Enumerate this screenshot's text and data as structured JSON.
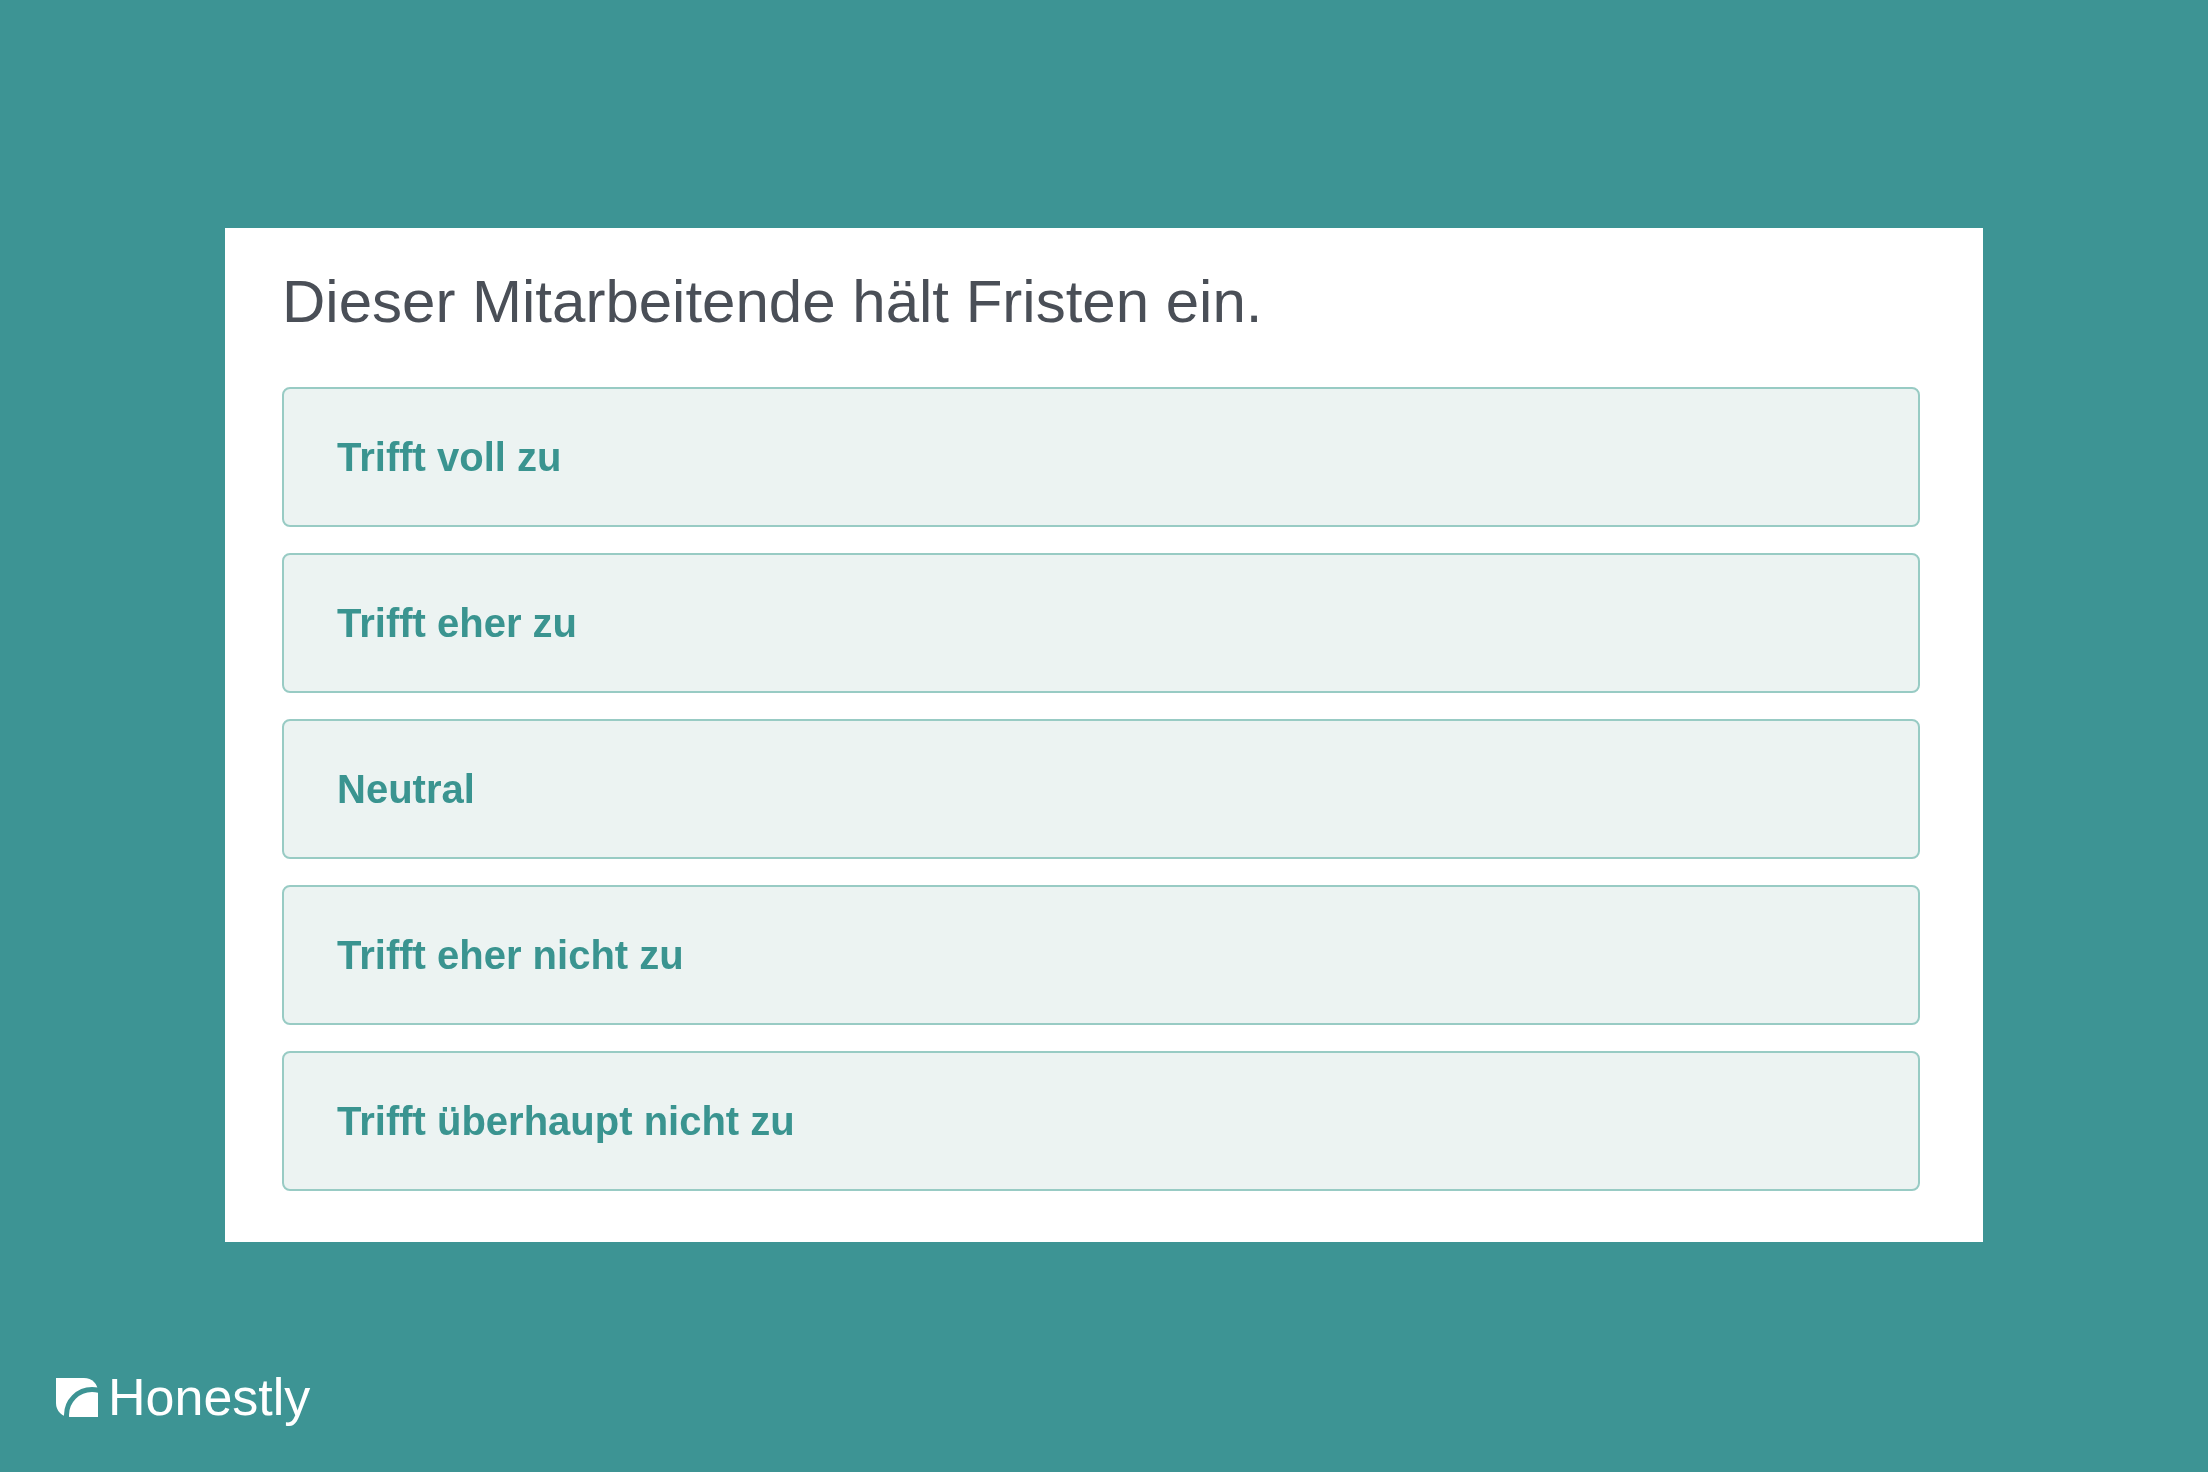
{
  "question": "Dieser Mitarbeitende hält Fristen ein.",
  "options": [
    {
      "label": "Trifft voll zu"
    },
    {
      "label": "Trifft eher zu"
    },
    {
      "label": "Neutral"
    },
    {
      "label": "Trifft eher nicht zu"
    },
    {
      "label": "Trifft überhaupt nicht zu"
    }
  ],
  "logo": {
    "text": "Honestly"
  }
}
